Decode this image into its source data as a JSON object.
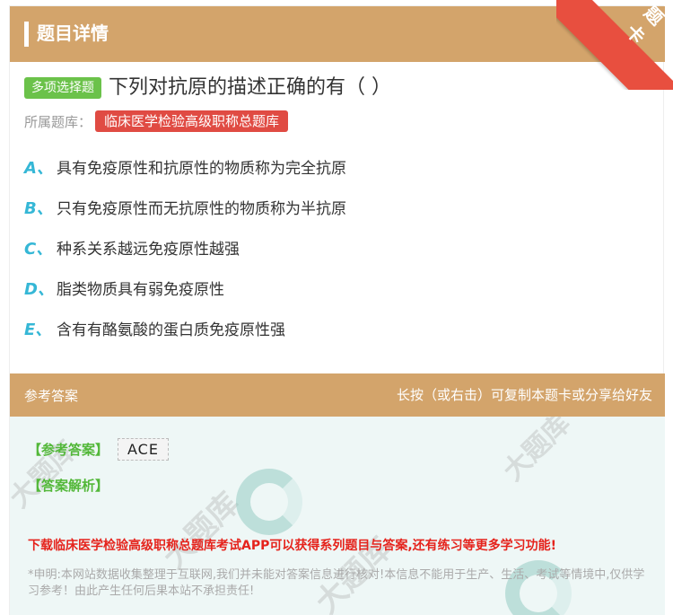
{
  "header": {
    "title": "题目详情",
    "ribbon_label": "题卡"
  },
  "question": {
    "type_badge": "多项选择题",
    "text": "下列对抗原的描述正确的有（      ）",
    "bank_label": "所属题库：",
    "bank_name": "临床医学检验高级职称总题库"
  },
  "options": [
    {
      "letter": "A、",
      "text": "具有免疫原性和抗原性的物质称为完全抗原"
    },
    {
      "letter": "B、",
      "text": "只有免疫原性而无抗原性的物质称为半抗原"
    },
    {
      "letter": "C、",
      "text": "种系关系越远免疫原性越强"
    },
    {
      "letter": "D、",
      "text": "脂类物质具有弱免疫原性"
    },
    {
      "letter": "E、",
      "text": "含有有酪氨酸的蛋白质免疫原性强"
    }
  ],
  "answer_bar": {
    "left_label": "参考答案",
    "right_hint": "长按（或右击）可复制本题卡或分享给好友"
  },
  "answer": {
    "ref_label": "【参考答案】",
    "value": "ACE",
    "analysis_label": "【答案解析】"
  },
  "promo": "下载临床医学检验高级职称总题库考试APP可以获得系列题目与答案,还有练习等更多学习功能!",
  "disclaimer": "*申明:本网站数据收集整理于互联网,我们并未能对答案信息进行核对!本信息不能用于生产、生活、考试等情境中,仅供学习参考！由此产生任何后果本站不承担责任!",
  "colors": {
    "header_bg": "#d3a46b",
    "badge_green": "#6bc24a",
    "bank_red": "#e04b43",
    "option_letter": "#35b7d6",
    "promo_red": "#e5231c"
  }
}
